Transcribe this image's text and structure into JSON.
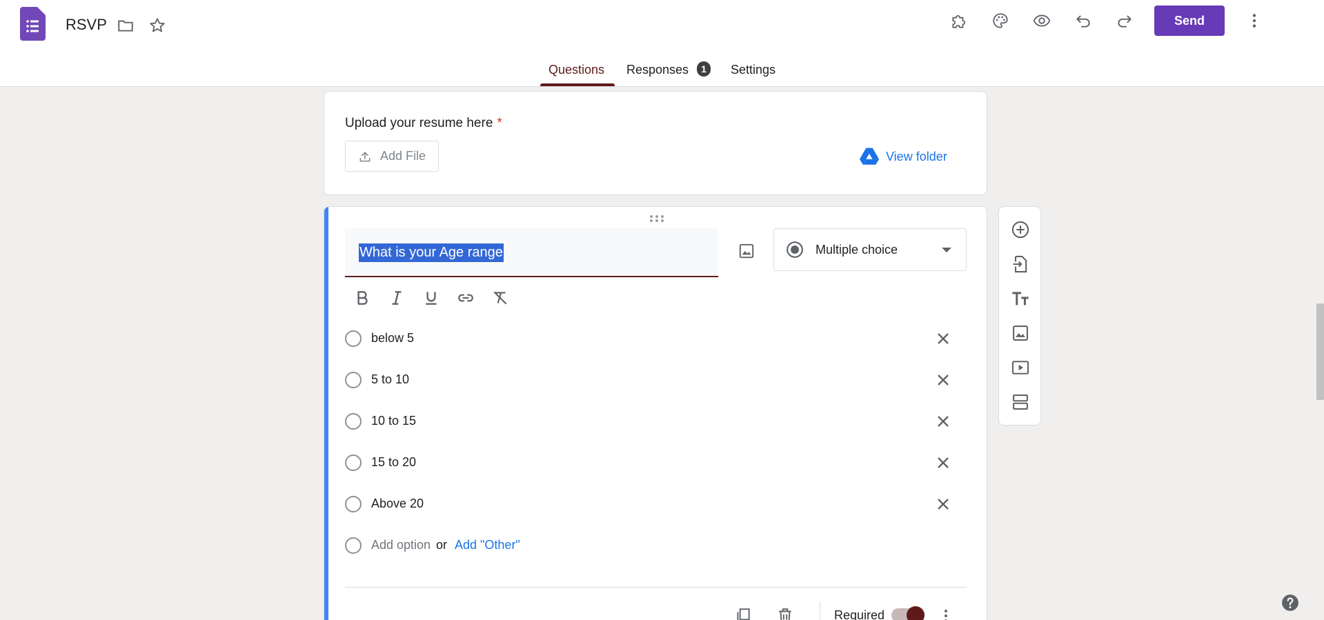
{
  "header": {
    "doc_title": "RSVP",
    "send_label": "Send",
    "icons": [
      "forms-logo-icon",
      "folder-icon",
      "star-icon",
      "addon-puzzle-icon",
      "palette-icon",
      "preview-eye-icon",
      "undo-icon",
      "redo-icon",
      "more-vert-icon"
    ]
  },
  "tabs": [
    {
      "label": "Questions",
      "active": true
    },
    {
      "label": "Responses",
      "badge": "1"
    },
    {
      "label": "Settings"
    }
  ],
  "upload_card": {
    "title": "Upload your resume here",
    "required_mark": "*",
    "add_file_label": "Add File",
    "view_folder_label": "View folder"
  },
  "question_card": {
    "question_text": "What is your Age range",
    "type_label": "Multiple choice",
    "options": [
      "below 5",
      "5 to 10",
      "10 to 15",
      "15 to 20",
      "Above 20"
    ],
    "add_option_label": "Add option",
    "or_label": "or",
    "add_other_label": "Add \"Other\"",
    "required_label": "Required",
    "required_on": true
  },
  "colors": {
    "brand": "#673ab7",
    "accent": "#5e1a1a",
    "link": "#1a73e8",
    "card_accent": "#4285f4",
    "selection": "#3367d6"
  }
}
